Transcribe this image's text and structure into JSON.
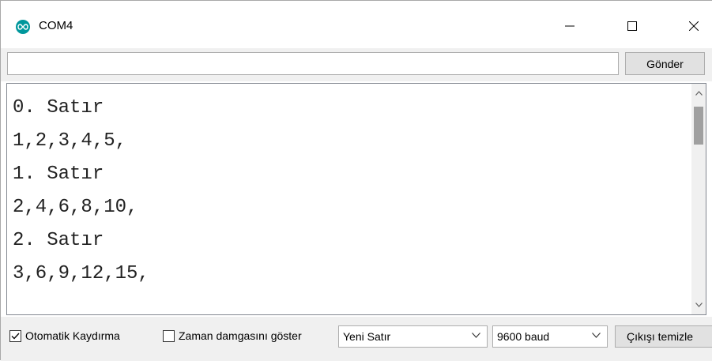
{
  "window": {
    "title": "COM4",
    "icon": "arduino-infinity-icon",
    "accent_color": "#00979c"
  },
  "controls": {
    "minimize": "minimize-icon",
    "maximize": "maximize-icon",
    "close": "close-icon"
  },
  "send": {
    "input_value": "",
    "button_label": "Gönder"
  },
  "output": {
    "lines": [
      "0. Satır",
      "1,2,3,4,5,",
      "1. Satır",
      "2,4,6,8,10,",
      "2. Satır",
      "3,6,9,12,15,"
    ]
  },
  "bottom": {
    "autoscroll_label": "Otomatik Kaydırma",
    "autoscroll_checked": true,
    "timestamp_label": "Zaman damgasını göster",
    "timestamp_checked": false,
    "line_ending_value": "Yeni Satır",
    "baud_value": "9600 baud",
    "clear_label": "Çıkışı temizle"
  }
}
